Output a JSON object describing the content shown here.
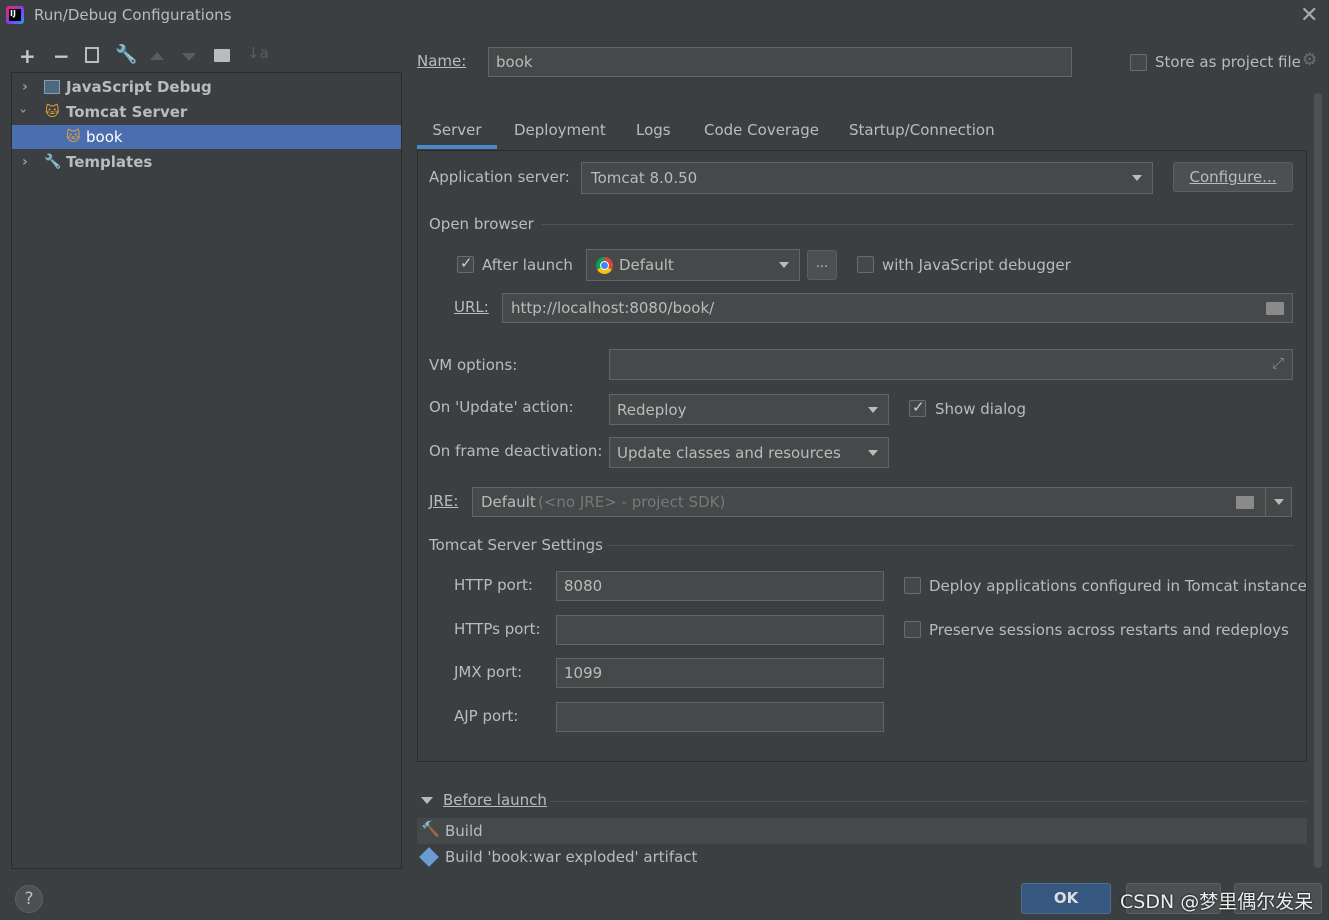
{
  "window": {
    "title": "Run/Debug Configurations"
  },
  "toolbar": {
    "icons": [
      "add-icon",
      "remove-icon",
      "copy-icon",
      "wrench-icon",
      "move-up-icon",
      "move-down-icon",
      "folder-add-icon",
      "sort-icon"
    ]
  },
  "tree": {
    "items": [
      {
        "label": "JavaScript Debug",
        "icon": "javascript-debug-icon"
      },
      {
        "label": "Tomcat Server",
        "icon": "tomcat-icon"
      },
      {
        "label": "book",
        "icon": "tomcat-icon"
      },
      {
        "label": "Templates",
        "icon": "wrench-icon"
      }
    ]
  },
  "name_row": {
    "label": "Name:",
    "value": "book",
    "store_label": "Store as project file"
  },
  "tabs": [
    "Server",
    "Deployment",
    "Logs",
    "Code Coverage",
    "Startup/Connection"
  ],
  "server": {
    "app_server_label": "Application server:",
    "app_server_value": "Tomcat 8.0.50",
    "configure_label": "Configure...",
    "open_browser_label": "Open browser",
    "after_launch_label": "After launch",
    "browser_value": "Default",
    "ellipsis_label": "...",
    "js_debugger_label": "with JavaScript debugger",
    "url_label": "URL:",
    "url_value": "http://localhost:8080/book/",
    "vm_options_label": "VM options:",
    "on_update_label": "On 'Update' action:",
    "on_update_value": "Redeploy",
    "show_dialog_label": "Show dialog",
    "on_frame_label": "On frame deactivation:",
    "on_frame_value": "Update classes and resources",
    "jre_label": "JRE:",
    "jre_value": "Default",
    "jre_hint": "(<no JRE> - project SDK)",
    "tomcat_settings_label": "Tomcat Server Settings",
    "http_port_label": "HTTP port:",
    "http_port_value": "8080",
    "https_port_label": "HTTPs port:",
    "https_port_value": "",
    "jmx_port_label": "JMX port:",
    "jmx_port_value": "1099",
    "ajp_port_label": "AJP port:",
    "ajp_port_value": "",
    "deploy_apps_label": "Deploy applications configured in Tomcat instance",
    "preserve_sessions_label": "Preserve sessions across restarts and redeploys"
  },
  "before_launch": {
    "label": "Before launch",
    "items": [
      "Build",
      "Build 'book:war exploded' artifact"
    ]
  },
  "footer": {
    "help": "?",
    "ok_label": "OK",
    "watermark": "CSDN @梦里偶尔发呆"
  },
  "colors": {
    "accent": "#4b6eaf",
    "selected_tree": "#4b6eaf",
    "ok_button": "#365880",
    "tab_underline": "#4a88c7"
  }
}
